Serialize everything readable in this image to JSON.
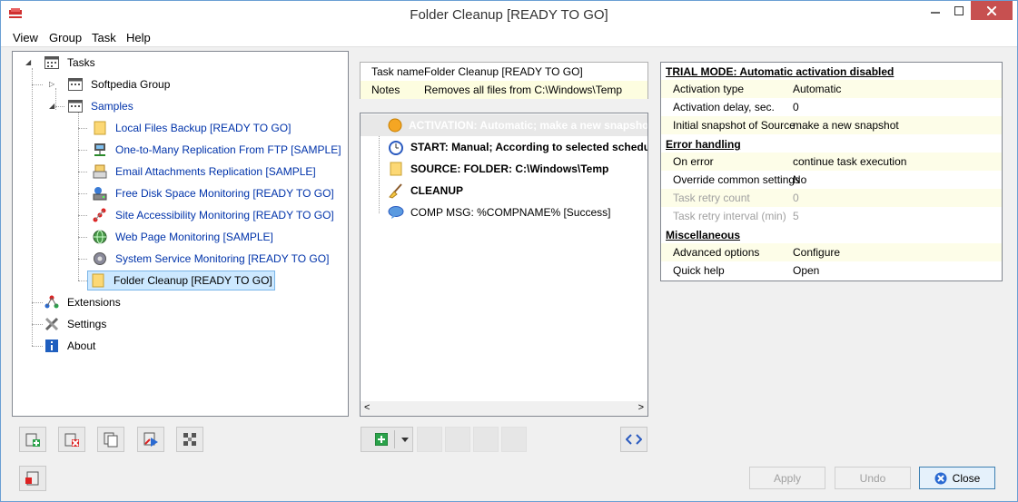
{
  "window": {
    "title": "Folder Cleanup [READY TO GO]"
  },
  "menu": [
    "View",
    "Group",
    "Task",
    "Help"
  ],
  "tree": {
    "root": "Tasks",
    "group": "Softpedia Group",
    "samples": "Samples",
    "items": [
      {
        "label": "Local Files Backup [READY TO GO]",
        "icon": "folder-icon"
      },
      {
        "label": "One-to-Many Replication From FTP [SAMPLE]",
        "icon": "network-icon"
      },
      {
        "label": "Email Attachments Replication [SAMPLE]",
        "icon": "email-icon"
      },
      {
        "label": "Free Disk Space Monitoring [READY TO GO]",
        "icon": "disk-icon"
      },
      {
        "label": "Site Accessibility Monitoring [READY TO GO]",
        "icon": "site-icon"
      },
      {
        "label": "Web Page Monitoring [SAMPLE]",
        "icon": "globe-icon"
      },
      {
        "label": "System Service Monitoring [READY TO GO]",
        "icon": "gear-icon"
      },
      {
        "label": "Folder Cleanup [READY TO GO]",
        "icon": "folder-icon"
      }
    ],
    "extensions": "Extensions",
    "settings": "Settings",
    "about": "About"
  },
  "task_info": {
    "name_key": "Task name",
    "name_val": "Folder Cleanup [READY TO GO]",
    "notes_key": "Notes",
    "notes_val": "Removes all files from C:\\Windows\\Temp"
  },
  "steps": {
    "activation": "ACTIVATION: Automatic; make a new snapshot",
    "start": "START: Manual; According to selected schedule",
    "source": "SOURCE: FOLDER: C:\\Windows\\Temp",
    "cleanup": "CLEANUP",
    "comp": "COMP MSG: %COMPNAME% [Success]"
  },
  "props": {
    "trial": "TRIAL MODE: Automatic activation disabled",
    "activation_type_k": "Activation type",
    "activation_type_v": "Automatic",
    "activation_delay_k": "Activation delay, sec.",
    "activation_delay_v": "0",
    "snapshot_k": "Initial snapshot of Source",
    "snapshot_v": "make a new snapshot",
    "error_head": "Error handling",
    "on_error_k": "On error",
    "on_error_v": "continue task execution",
    "override_k": "Override common settings",
    "override_v": "No",
    "retry_count_k": "Task retry count",
    "retry_count_v": "0",
    "retry_interval_k": "Task retry interval (min)",
    "retry_interval_v": "5",
    "misc_head": "Miscellaneous",
    "advanced_k": "Advanced options",
    "advanced_v": "Configure",
    "help_k": "Quick help",
    "help_v": "Open"
  },
  "buttons": {
    "apply": "Apply",
    "undo": "Undo",
    "close": "Close"
  },
  "colors": {
    "link_blue": "#0033aa",
    "selection": "#cce8ff",
    "close_red": "#c75050"
  }
}
